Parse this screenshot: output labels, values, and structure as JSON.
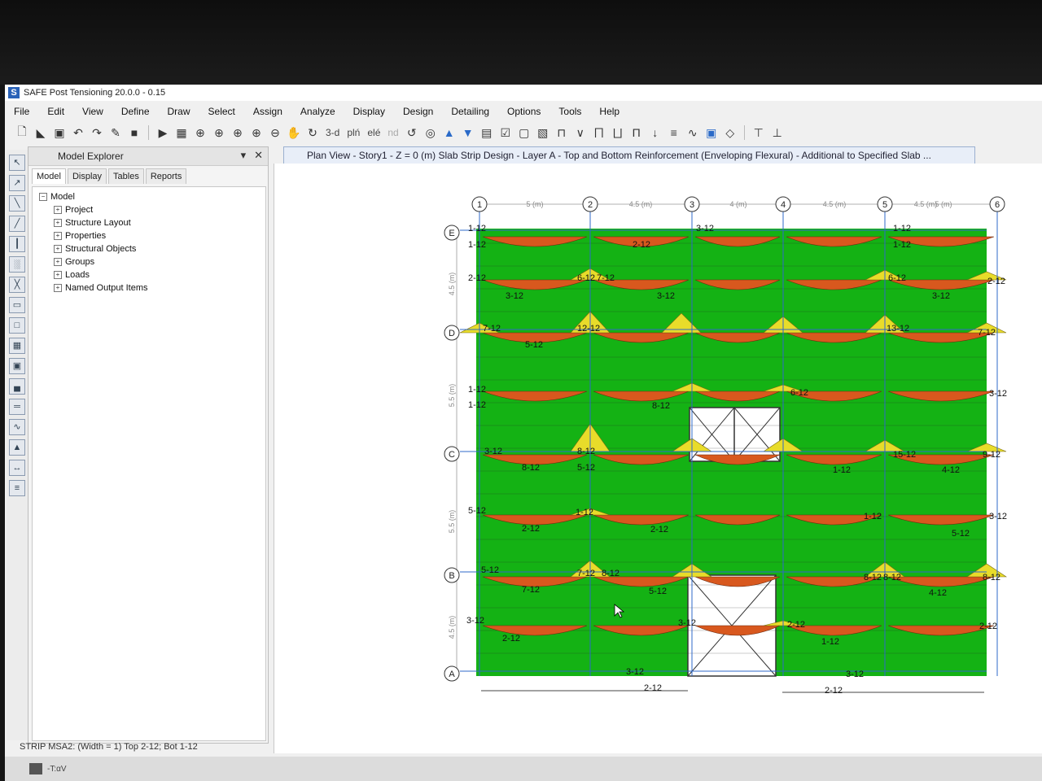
{
  "window": {
    "title": "SAFE Post Tensioning 20.0.0 - 0.15",
    "app_icon": "S"
  },
  "menu": [
    "File",
    "Edit",
    "View",
    "Define",
    "Draw",
    "Select",
    "Assign",
    "Analyze",
    "Display",
    "Design",
    "Detailing",
    "Options",
    "Tools",
    "Help"
  ],
  "toolbar": {
    "view_3d": "3-d",
    "view_plan": "plń",
    "view_elev": "elé",
    "view_nd": "nd"
  },
  "model_explorer": {
    "title": "Model Explorer",
    "tabs": [
      "Model",
      "Display",
      "Tables",
      "Reports"
    ],
    "active_tab": "Model",
    "root": "Model",
    "items": [
      "Project",
      "Structure Layout",
      "Properties",
      "Structural Objects",
      "Groups",
      "Loads",
      "Named Output Items"
    ]
  },
  "plan_view": {
    "title": "Plan View - Story1 - Z = 0 (m)  Slab Strip Design - Layer A - Top and Bottom Reinforcement (Enveloping Flexural)  - Additional to Specified Slab ...",
    "grid_x": [
      "1",
      "2",
      "3",
      "4",
      "5",
      "6"
    ],
    "grid_y": [
      "E",
      "D",
      "C",
      "B",
      "A"
    ],
    "x_spacings": [
      "5 (m)",
      "4.5 (m)",
      "4 (m)",
      "4.5 (m)",
      "4.5 (m)",
      "5 (m)"
    ],
    "y_spacings": [
      "4.5 (m)",
      "5.5 (m)",
      "5.5 (m)",
      "4.5 (m)"
    ],
    "labels": [
      "1-12",
      "1-12",
      "3-12",
      "2-12",
      "1-12",
      "1-12",
      "2-12",
      "6-12",
      "7-12",
      "6-12",
      "2-12",
      "3-12",
      "3-12",
      "3-12",
      "7-12",
      "12-12",
      "13-12",
      "7-12",
      "5-12",
      "1-12",
      "6-12",
      "1-12",
      "8-12",
      "3-12",
      "3-12",
      "8-12",
      "15-12",
      "9-12",
      "8-12",
      "5-12",
      "1-12",
      "4-12",
      "5-12",
      "1-12",
      "2-12",
      "2-12",
      "1-12",
      "5-12",
      "3-12",
      "5-12",
      "7-12",
      "8-12",
      "8-12",
      "8-12",
      "8-12",
      "7-12",
      "5-12",
      "4-12",
      "3-12",
      "2-12",
      "3-12",
      "2-12",
      "1-12",
      "2-12",
      "3-12",
      "3-12",
      "2-12",
      "2-12",
      "3-12",
      "2-12"
    ],
    "colors": {
      "slab": "#14b214",
      "top_steel": "#e8dc2a",
      "bottom_steel": "#d8581e",
      "grid_line": "#2f68c8",
      "opening_bg": "#ffffff"
    }
  },
  "status_bar": {
    "text": "STRIP MSA2:  (Width = 1)  Top 2-12; Bot 1-12"
  },
  "taskbar": {
    "text": "-T:αV"
  }
}
